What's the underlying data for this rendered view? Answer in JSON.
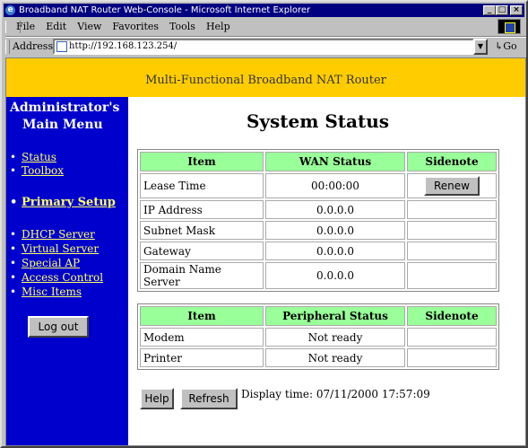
{
  "window": {
    "title": "Broadband NAT Router Web-Console - Microsoft Internet Explorer",
    "controls": [
      "_",
      "□",
      "×"
    ]
  },
  "menubar": [
    "File",
    "Edit",
    "View",
    "Favorites",
    "Tools",
    "Help"
  ],
  "address": {
    "label": "Address",
    "url": "http://192.168.123.254/",
    "go": "Go"
  },
  "banner": "Multi-Functional Broadband NAT Router",
  "sidebar": {
    "title_line1": "Administrator's",
    "title_line2": "Main Menu",
    "items": [
      "Status",
      "Toolbox",
      "Primary Setup",
      "DHCP Server",
      "Virtual Server",
      "Special AP",
      "Access Control",
      "Misc Items"
    ],
    "logout": "Log out"
  },
  "main": {
    "heading": "System Status",
    "wan_table": {
      "headers": [
        "Item",
        "WAN Status",
        "Sidenote"
      ],
      "rows": [
        [
          "Lease Time",
          "00:00:00",
          ""
        ],
        [
          "IP Address",
          "0.0.0.0",
          ""
        ],
        [
          "Subnet Mask",
          "0.0.0.0",
          ""
        ],
        [
          "Gateway",
          "0.0.0.0",
          ""
        ],
        [
          "Domain Name Server",
          "0.0.0.0",
          ""
        ]
      ],
      "renew": "Renew"
    },
    "peripheral_table": {
      "headers": [
        "Item",
        "Peripheral Status",
        "Sidenote"
      ],
      "rows": [
        [
          "Modem",
          "Not ready",
          ""
        ],
        [
          "Printer",
          "Not ready",
          ""
        ]
      ]
    },
    "help": "Help",
    "refresh": "Refresh",
    "display_time": "Display time: 07/11/2000 17:57:09"
  }
}
